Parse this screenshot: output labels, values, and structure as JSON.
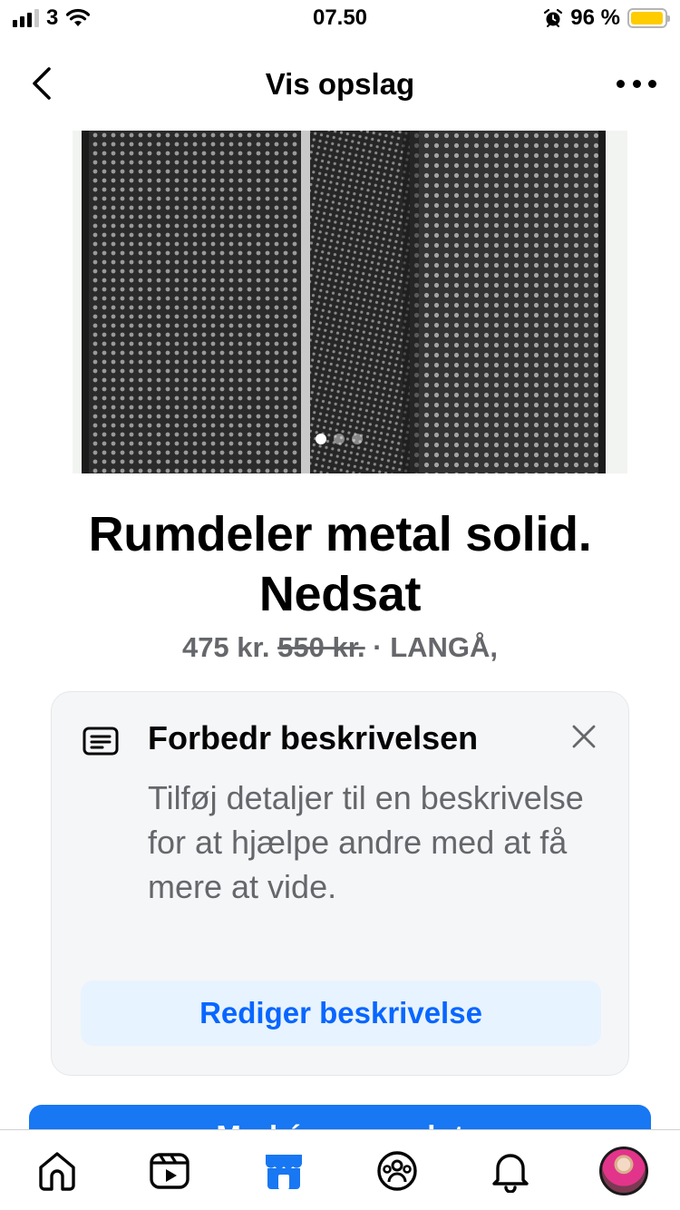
{
  "status_bar": {
    "carrier": "3",
    "time": "07.50",
    "battery_percent": "96 %",
    "battery_level": 0.96,
    "signal_bars": 3,
    "icons": [
      "signal-icon",
      "wifi-icon",
      "alarm-icon",
      "battery-icon"
    ]
  },
  "header": {
    "title": "Vis opslag",
    "back_icon": "chevron-left-icon",
    "more_icon": "more-dots-icon"
  },
  "listing": {
    "image_count": 3,
    "active_image_index": 0,
    "title_line1": "Rumdeler metal solid.",
    "title_line2": "Nedsat",
    "price": "475 kr.",
    "old_price": "550 kr.",
    "location": " · LANGÅ,"
  },
  "suggestion_card": {
    "icon": "description-icon",
    "title": "Forbedr beskrivelsen",
    "body": "Tilføj detaljer til en beskrivelse for at hjælpe andre med at få mere at vide.",
    "button_label": "Rediger beskrivelse",
    "close_icon": "close-icon"
  },
  "primary_button": {
    "label": "Markér som solgt"
  },
  "tab_bar": {
    "tabs": [
      {
        "icon": "home-icon"
      },
      {
        "icon": "video-icon"
      },
      {
        "icon": "marketplace-icon",
        "active": true
      },
      {
        "icon": "groups-icon"
      },
      {
        "icon": "bell-icon"
      },
      {
        "icon": "profile-avatar"
      }
    ]
  },
  "colors": {
    "accent": "#1877f2",
    "link_blue": "#0866ff",
    "secondary_text": "#65676b",
    "card_bg": "#f5f6f8",
    "button_tint": "#e7f3ff",
    "battery": "#ffcc00"
  }
}
